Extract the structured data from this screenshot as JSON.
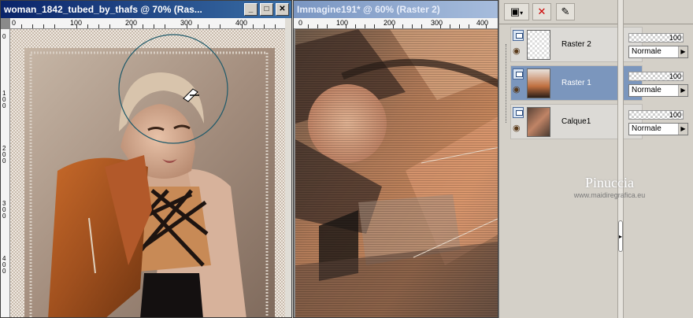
{
  "left_window": {
    "title": "woman_1842_tubed_by_thafs @  70% (Ras...",
    "buttons": {
      "minimize": "_",
      "maximize": "□",
      "close": "✕"
    },
    "ruler_h": [
      "0",
      "100",
      "200",
      "300",
      "400"
    ],
    "ruler_v": [
      "0",
      "1\n0\n0",
      "2\n0\n0",
      "3\n0\n0",
      "4\n0\n0"
    ]
  },
  "right_window": {
    "title": "Immagine191* @  60% (Raster 2)",
    "ruler_h": [
      "0",
      "100",
      "200",
      "300",
      "400"
    ]
  },
  "layers": {
    "rows": [
      {
        "name": "Raster 2",
        "opacity": "100",
        "blend": "Normale",
        "selected": false
      },
      {
        "name": "Raster 1",
        "opacity": "100",
        "blend": "Normale",
        "selected": true
      },
      {
        "name": "Calque1",
        "opacity": "100",
        "blend": "Normale",
        "selected": false
      }
    ]
  },
  "watermark": {
    "name": "Pinuccia",
    "url": "www.maidiregrafica.eu"
  },
  "icons": [
    "layer-new-icon",
    "delete-layer-icon",
    "brush-properties-icon",
    "eye-icon"
  ]
}
